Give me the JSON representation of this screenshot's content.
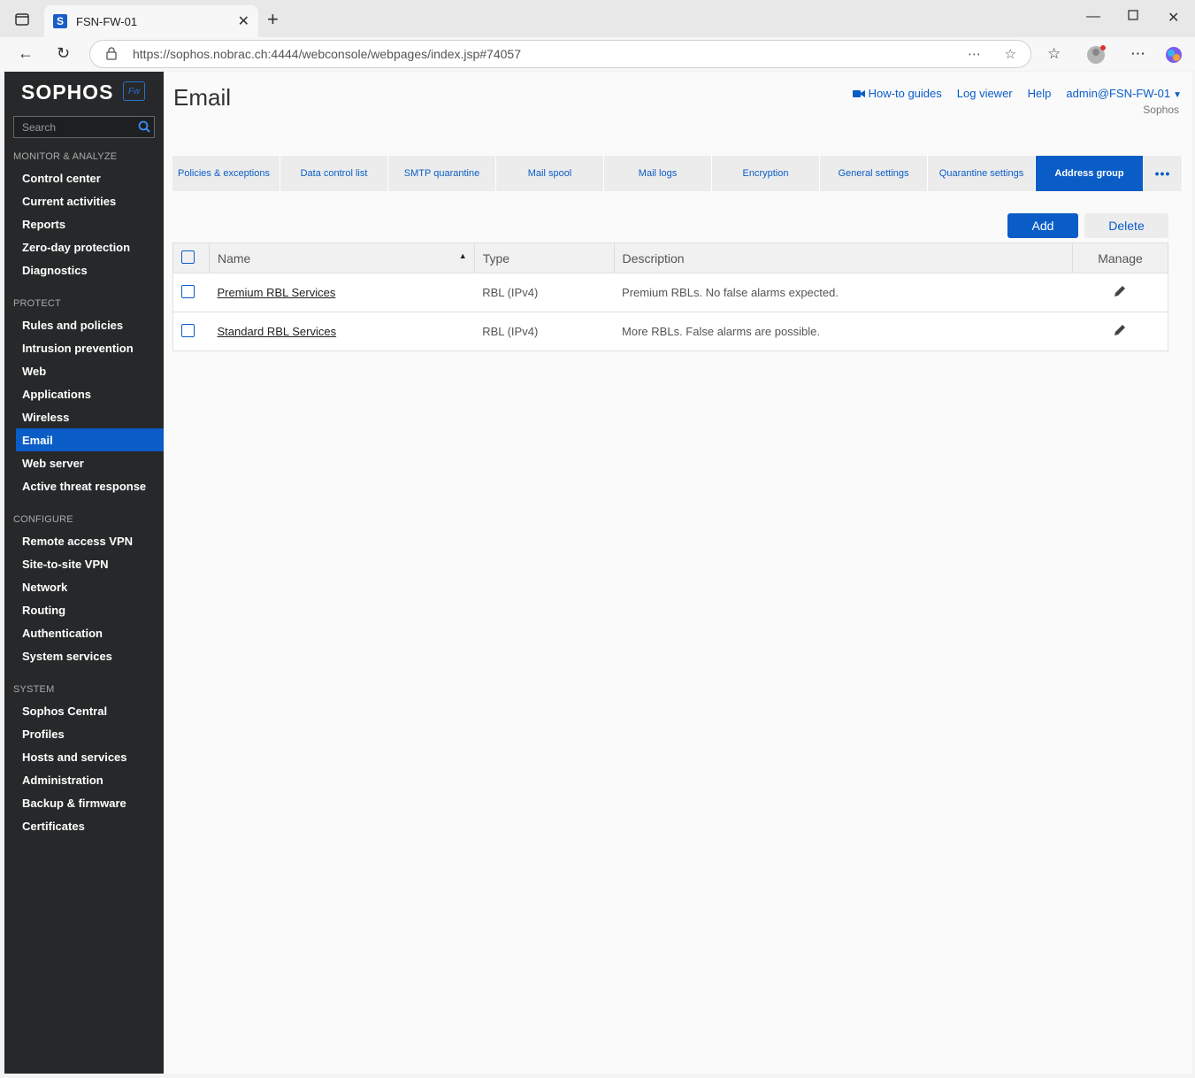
{
  "browser": {
    "tab_title": "FSN-FW-01",
    "favicon_letter": "S",
    "url": "https://sophos.nobrac.ch:4444/webconsole/webpages/index.jsp#74057"
  },
  "sidebar": {
    "logo": "SOPHOS",
    "badge": "Fw",
    "search_placeholder": "Search",
    "sections": [
      {
        "title": "MONITOR & ANALYZE",
        "items": [
          "Control center",
          "Current activities",
          "Reports",
          "Zero-day protection",
          "Diagnostics"
        ]
      },
      {
        "title": "PROTECT",
        "items": [
          "Rules and policies",
          "Intrusion prevention",
          "Web",
          "Applications",
          "Wireless",
          "Email",
          "Web server",
          "Active threat response"
        ]
      },
      {
        "title": "CONFIGURE",
        "items": [
          "Remote access VPN",
          "Site-to-site VPN",
          "Network",
          "Routing",
          "Authentication",
          "System services"
        ]
      },
      {
        "title": "SYSTEM",
        "items": [
          "Sophos Central",
          "Profiles",
          "Hosts and services",
          "Administration",
          "Backup & firmware",
          "Certificates"
        ]
      }
    ],
    "active_item": "Email"
  },
  "header": {
    "title": "Email",
    "links": {
      "howto": "How-to guides",
      "logviewer": "Log viewer",
      "help": "Help",
      "user": "admin@FSN-FW-01"
    },
    "org": "Sophos"
  },
  "tabs": [
    "Policies & exceptions",
    "Data control list",
    "SMTP quarantine",
    "Mail spool",
    "Mail logs",
    "Encryption",
    "General settings",
    "Quarantine settings",
    "Address group"
  ],
  "active_tab": "Address group",
  "actions": {
    "add": "Add",
    "delete": "Delete"
  },
  "table": {
    "columns": {
      "name": "Name",
      "type": "Type",
      "description": "Description",
      "manage": "Manage"
    },
    "rows": [
      {
        "name": "Premium RBL Services",
        "type": "RBL (IPv4)",
        "description": "Premium RBLs. No false alarms expected."
      },
      {
        "name": "Standard RBL Services",
        "type": "RBL (IPv4)",
        "description": "More RBLs. False alarms are possible."
      }
    ]
  },
  "colors": {
    "accent": "#0a5dc7",
    "sidebar_bg": "#262829"
  }
}
